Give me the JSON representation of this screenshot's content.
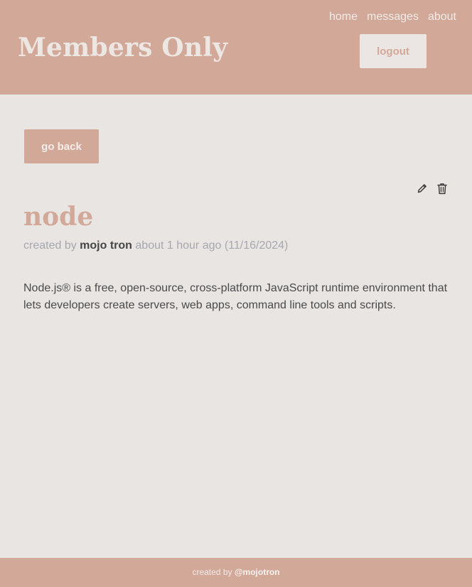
{
  "header": {
    "brand": "Members Only",
    "nav": {
      "home": "home",
      "messages": "messages",
      "about": "about"
    },
    "logout_label": "logout"
  },
  "main": {
    "back_label": "go back",
    "post": {
      "title": "node",
      "meta": {
        "prefix": "created by",
        "author": "mojo tron",
        "time": "about 1 hour ago (11/16/2024)"
      },
      "body": "Node.js® is a free, open-source, cross-platform JavaScript runtime environment that lets developers create servers, web apps, command line tools and scripts.",
      "actions": {
        "edit_icon": "pencil-icon",
        "delete_icon": "trash-icon"
      }
    }
  },
  "footer": {
    "prefix": "created by",
    "handle": "@mojotron"
  },
  "colors": {
    "accent": "#d2a898",
    "background": "#e9e5e3",
    "text": "#4a4a4a",
    "muted": "#a7a7ae"
  }
}
